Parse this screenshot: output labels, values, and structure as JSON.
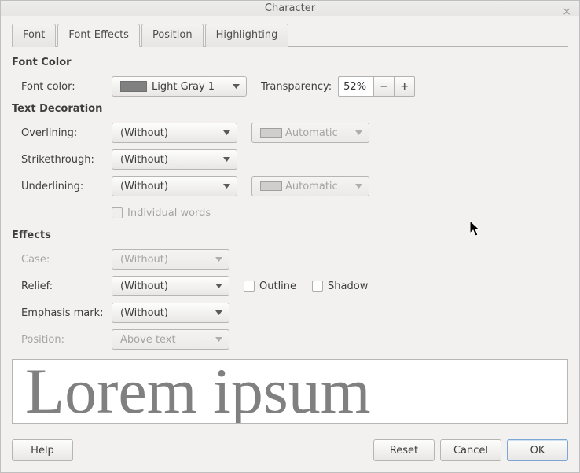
{
  "window": {
    "title": "Character"
  },
  "tabs": [
    {
      "label": "Font"
    },
    {
      "label": "Font Effects"
    },
    {
      "label": "Position"
    },
    {
      "label": "Highlighting"
    }
  ],
  "sections": {
    "font_color": {
      "title": "Font Color",
      "label": "Font color:",
      "value": "Light Gray 1",
      "transparency_label": "Transparency:",
      "transparency_value": "52%"
    },
    "text_decoration": {
      "title": "Text Decoration",
      "overlining_label": "Overlining:",
      "overlining_value": "(Without)",
      "overlining_color": "Automatic",
      "strikethrough_label": "Strikethrough:",
      "strikethrough_value": "(Without)",
      "underlining_label": "Underlining:",
      "underlining_value": "(Without)",
      "underlining_color": "Automatic",
      "individual_words_label": "Individual words"
    },
    "effects": {
      "title": "Effects",
      "case_label": "Case:",
      "case_value": "(Without)",
      "relief_label": "Relief:",
      "relief_value": "(Without)",
      "outline_label": "Outline",
      "shadow_label": "Shadow",
      "emphasis_label": "Emphasis mark:",
      "emphasis_value": "(Without)",
      "position_label": "Position:",
      "position_value": "Above text"
    }
  },
  "preview": {
    "text": "Lorem ipsum"
  },
  "buttons": {
    "help": "Help",
    "reset": "Reset",
    "cancel": "Cancel",
    "ok": "OK"
  }
}
